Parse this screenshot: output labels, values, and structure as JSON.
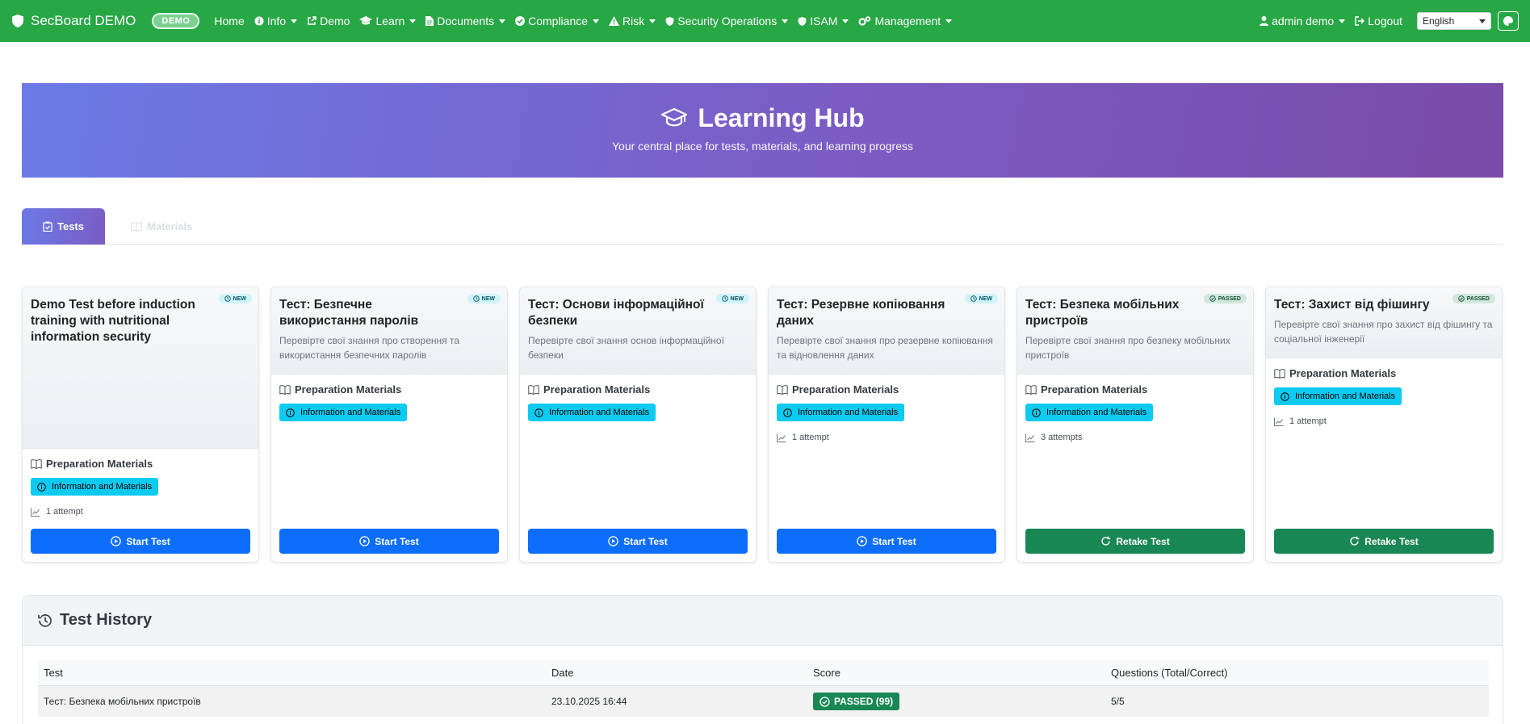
{
  "navbar": {
    "brand": "SecBoard DEMO",
    "badge": "DEMO",
    "items": [
      {
        "label": "Home",
        "icon": "none"
      },
      {
        "label": "Info",
        "icon": "info-circle-icon",
        "dropdown": true
      },
      {
        "label": "Demo",
        "icon": "external-link-icon"
      },
      {
        "label": "Learn",
        "icon": "graduation-cap-icon",
        "dropdown": true
      },
      {
        "label": "Documents",
        "icon": "file-icon",
        "dropdown": true
      },
      {
        "label": "Compliance",
        "icon": "check-circle-icon",
        "dropdown": true
      },
      {
        "label": "Risk",
        "icon": "warning-triangle-icon",
        "dropdown": true
      },
      {
        "label": "Security Operations",
        "icon": "shield-icon",
        "dropdown": true
      },
      {
        "label": "ISAM",
        "icon": "shield-icon",
        "dropdown": true
      },
      {
        "label": "Management",
        "icon": "cogs-icon",
        "dropdown": true
      }
    ],
    "user": "admin demo",
    "logout": "Logout",
    "language": "English"
  },
  "hero": {
    "title": "Learning Hub",
    "subtitle": "Your central place for tests, materials, and learning progress"
  },
  "tabs": {
    "tests": "Tests",
    "materials": "Materials"
  },
  "cards": [
    {
      "title": "Demo Test before induction training with nutritional information security",
      "description": "",
      "status": "NEW",
      "prep_title": "Preparation Materials",
      "material_button": "Information and Materials",
      "attempts": "1 attempt",
      "action": "Start Test"
    },
    {
      "title": "Тест: Безпечне використання паролів",
      "description": "Перевірте свої знання про створення та використання безпечних паролів",
      "status": "NEW",
      "prep_title": "Preparation Materials",
      "material_button": "Information and Materials",
      "attempts": "",
      "action": "Start Test"
    },
    {
      "title": "Тест: Основи інформаційної безпеки",
      "description": "Перевірте свої знання основ інформаційної безпеки",
      "status": "NEW",
      "prep_title": "Preparation Materials",
      "material_button": "Information and Materials",
      "attempts": "",
      "action": "Start Test"
    },
    {
      "title": "Тест: Резервне копіювання даних",
      "description": "Перевірте свої знання про резервне копіювання та відновлення даних",
      "status": "NEW",
      "prep_title": "Preparation Materials",
      "material_button": "Information and Materials",
      "attempts": "1 attempt",
      "action": "Start Test"
    },
    {
      "title": "Тест: Безпека мобільних пристроїв",
      "description": "Перевірте свої знання про безпеку мобільних пристроїв",
      "status": "PASSED",
      "prep_title": "Preparation Materials",
      "material_button": "Information and Materials",
      "attempts": "3 attempts",
      "action": "Retake Test"
    },
    {
      "title": "Тест: Захист від фішингу",
      "description": "Перевірте свої знання про захист від фішингу та соціальної інженерії",
      "status": "PASSED",
      "prep_title": "Preparation Materials",
      "material_button": "Information and Materials",
      "attempts": "1 attempt",
      "action": "Retake Test"
    }
  ],
  "history": {
    "title": "Test History",
    "columns": [
      "Test",
      "Date",
      "Score",
      "Questions (Total/Correct)"
    ],
    "rows": [
      {
        "test": "Тест: Безпека мобільних пристроїв",
        "date": "23.10.2025 16:44",
        "score": "PASSED (99)",
        "questions": "5/5"
      }
    ]
  },
  "colors": {
    "navbar": "#28a745",
    "primary": "#0d6efd",
    "success": "#198754",
    "info": "#0dcaf0",
    "hero_start": "#6b7ae6",
    "hero_end": "#7a4ba8"
  }
}
